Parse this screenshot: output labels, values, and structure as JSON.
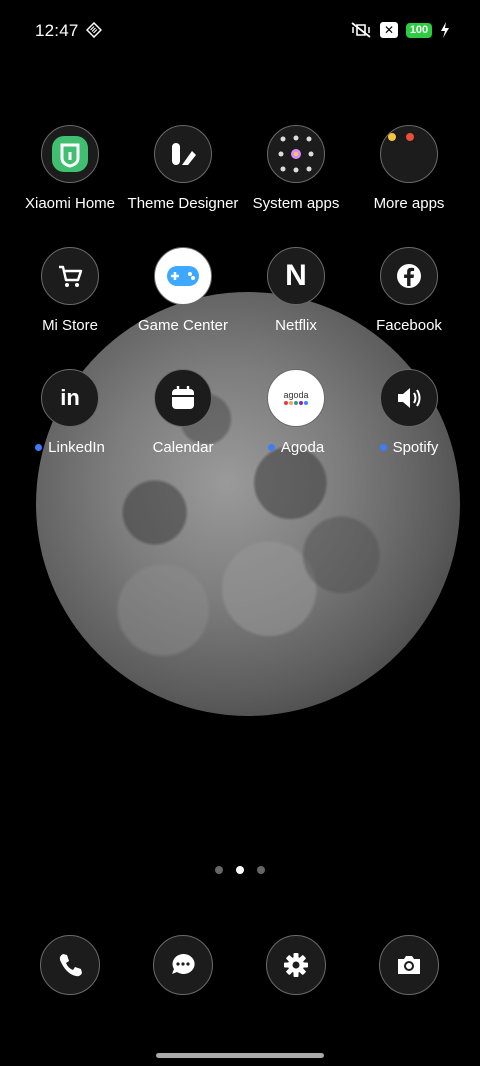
{
  "status_bar": {
    "time": "12:47",
    "x_box": "✕",
    "battery_level": "100",
    "battery_color": "#2ecc40"
  },
  "apps_row1": [
    {
      "label": "Xiaomi Home",
      "icon": "xiaomi-home-icon"
    },
    {
      "label": "Theme Designer",
      "icon": "theme-designer-icon"
    },
    {
      "label": "System apps",
      "icon": "system-apps-folder-icon"
    },
    {
      "label": "More apps",
      "icon": "more-apps-folder-icon"
    }
  ],
  "apps_row2": [
    {
      "label": "Mi Store",
      "icon": "cart-icon"
    },
    {
      "label": "Game Center",
      "icon": "gamepad-icon"
    },
    {
      "label": "Netflix",
      "icon": "netflix-icon"
    },
    {
      "label": "Facebook",
      "icon": "facebook-icon"
    }
  ],
  "apps_row3": [
    {
      "label": "LinkedIn",
      "icon": "linkedin-icon",
      "new": true
    },
    {
      "label": "Calendar",
      "icon": "calendar-icon",
      "new": false
    },
    {
      "label": "Agoda",
      "icon": "agoda-icon",
      "new": true
    },
    {
      "label": "Spotify",
      "icon": "speaker-icon",
      "new": true
    }
  ],
  "agoda_text": "agoda",
  "netflix_text": "N",
  "pager": {
    "pages": 3,
    "current": 2
  },
  "dock": [
    {
      "icon": "phone-icon"
    },
    {
      "icon": "messages-icon"
    },
    {
      "icon": "settings-icon"
    },
    {
      "icon": "camera-icon"
    }
  ],
  "colors": {
    "new_dot": "#3d7cff",
    "xiaomi_green": "#3fbf6f"
  }
}
